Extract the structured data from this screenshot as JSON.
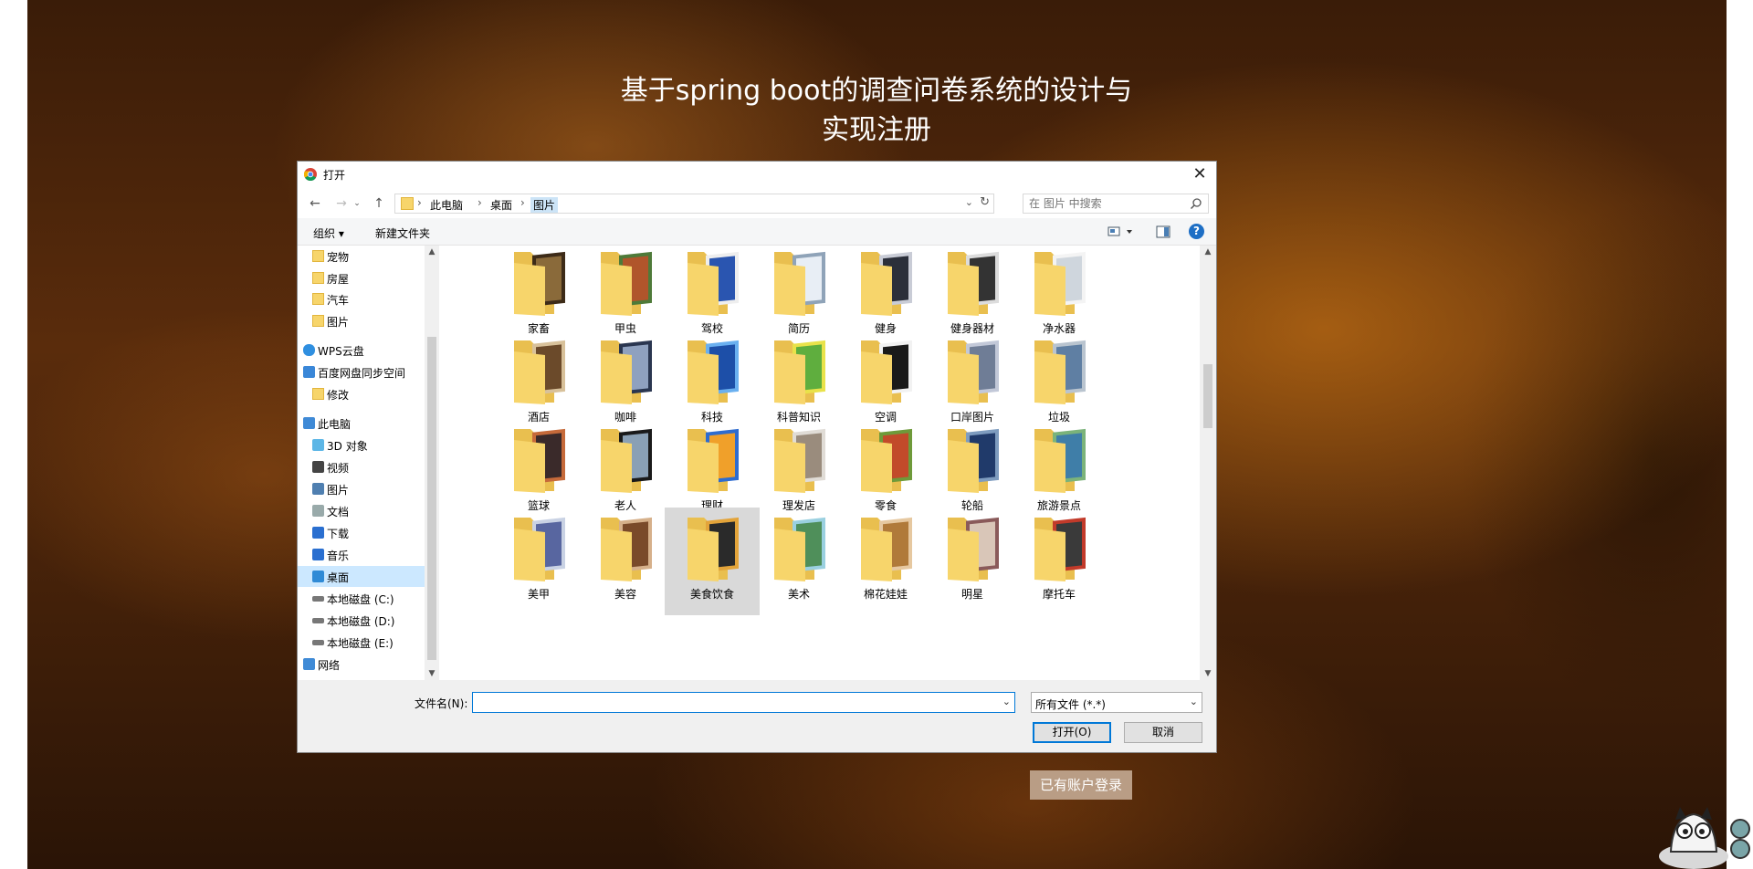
{
  "page": {
    "heading_line1": "基于spring boot的调查问卷系统的设计与",
    "heading_line2": "实现注册",
    "login_link": "已有账户登录"
  },
  "dialog": {
    "title": "打开",
    "breadcrumb": [
      "此电脑",
      "桌面",
      "图片"
    ],
    "search_placeholder": "在 图片 中搜索",
    "toolbar": {
      "organize": "组织 ▾",
      "new_folder": "新建文件夹"
    },
    "sidebar": [
      {
        "label": "宠物",
        "icon": "folder-icon"
      },
      {
        "label": "房屋",
        "icon": "folder-icon"
      },
      {
        "label": "汽车",
        "icon": "folder-icon"
      },
      {
        "label": "图片",
        "icon": "folder-icon"
      },
      {
        "label": "WPS云盘",
        "icon": "cloud-icon"
      },
      {
        "label": "百度网盘同步空间",
        "icon": "sync-icon"
      },
      {
        "label": "修改",
        "icon": "folder-icon"
      },
      {
        "label": "此电脑",
        "icon": "computer-icon"
      },
      {
        "label": "3D 对象",
        "icon": "cube-icon"
      },
      {
        "label": "视频",
        "icon": "video-icon"
      },
      {
        "label": "图片",
        "icon": "pictures-icon"
      },
      {
        "label": "文档",
        "icon": "document-icon"
      },
      {
        "label": "下载",
        "icon": "download-icon"
      },
      {
        "label": "音乐",
        "icon": "music-icon"
      },
      {
        "label": "桌面",
        "icon": "desktop-icon",
        "selected": true
      },
      {
        "label": "本地磁盘 (C:)",
        "icon": "drive-icon"
      },
      {
        "label": "本地磁盘 (D:)",
        "icon": "drive-icon"
      },
      {
        "label": "本地磁盘 (E:)",
        "icon": "drive-icon"
      },
      {
        "label": "网络",
        "icon": "network-icon"
      }
    ],
    "folders": [
      "家畜",
      "甲虫",
      "驾校",
      "简历",
      "健身",
      "健身器材",
      "净水器",
      "酒店",
      "咖啡",
      "科技",
      "科普知识",
      "空调",
      "口岸图片",
      "垃圾",
      "篮球",
      "老人",
      "理财",
      "理发店",
      "零食",
      "轮船",
      "旅游景点",
      "美甲",
      "美容",
      "美食饮食",
      "美术",
      "棉花娃娃",
      "明星",
      "摩托车"
    ],
    "selected_folder": "美食饮食",
    "filename_label": "文件名(N):",
    "filename_value": "",
    "filetype": "所有文件 (*.*)",
    "open_button": "打开(O)",
    "cancel_button": "取消"
  },
  "colors": {
    "accent": "#0078d7",
    "folder": "#f7d56b",
    "login_bg": "#b99d85",
    "selected_nav": "#cce8ff"
  }
}
